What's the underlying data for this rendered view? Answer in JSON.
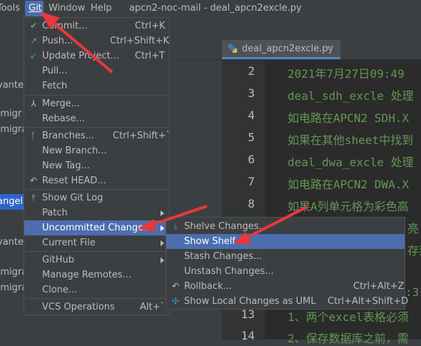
{
  "menubar": {
    "tools": "Tools",
    "git": "Git",
    "window": "Window",
    "help": "Help",
    "title": "apcn2-noc-mail - deal_apcn2excle.py"
  },
  "left_panel": {
    "texts": [
      "vanted",
      "\\migr",
      "\\migra",
      "angel",
      "vanted",
      "\\migra",
      "\\migra"
    ]
  },
  "editor": {
    "tab_label": "deal_apcn2excle.py",
    "line_numbers": [
      "2",
      "3",
      "4",
      "5",
      "6",
      "7",
      "8",
      "13",
      "14"
    ],
    "visible_code": [
      "2021年7月27日09:49",
      "deal_sdh_excle 处理",
      "如电路在APCN2 SDH.X",
      "如果在其他sheet中找到",
      "deal_dwa_excle 处理",
      "如电路在APCN2 DWA.X",
      "如果A列单元格为彩色高",
      "亮",
      "存到",
      ":3",
      "1、两个excel表格必须",
      "2、保存数据库之前，需"
    ]
  },
  "git_menu": {
    "items": [
      {
        "label": "Commit...",
        "shortcut": "Ctrl+K"
      },
      {
        "label": "Push...",
        "shortcut": "Ctrl+Shift+K"
      },
      {
        "label": "Update Project...",
        "shortcut": "Ctrl+T"
      },
      {
        "label": "Pull..."
      },
      {
        "label": "Fetch"
      },
      {
        "label": "Merge..."
      },
      {
        "label": "Rebase..."
      },
      {
        "label": "Branches...",
        "shortcut": "Ctrl+Shift+`"
      },
      {
        "label": "New Branch..."
      },
      {
        "label": "New Tag..."
      },
      {
        "label": "Reset HEAD..."
      },
      {
        "label": "Show Git Log"
      },
      {
        "label": "Patch"
      },
      {
        "label": "Uncommitted Changes"
      },
      {
        "label": "Current File"
      },
      {
        "label": "GitHub"
      },
      {
        "label": "Manage Remotes..."
      },
      {
        "label": "Clone..."
      },
      {
        "label": "VCS Operations",
        "shortcut": "Alt+`"
      }
    ]
  },
  "submenu": {
    "items": [
      {
        "label": "Shelve Changes..."
      },
      {
        "label": "Show Shelf"
      },
      {
        "label": "Stash Changes..."
      },
      {
        "label": "Unstash Changes..."
      },
      {
        "label": "Rollback...",
        "shortcut": "Ctrl+Alt+Z"
      },
      {
        "label": "Show Local Changes as UML",
        "shortcut": "Ctrl+Alt+Shift+D"
      }
    ]
  },
  "colors": {
    "menu_bg": "#3c3f41",
    "highlight": "#4b6eaf",
    "editor_bg": "#2b2b2b",
    "code_green": "#629755",
    "annotation_red": "#e8383d"
  }
}
